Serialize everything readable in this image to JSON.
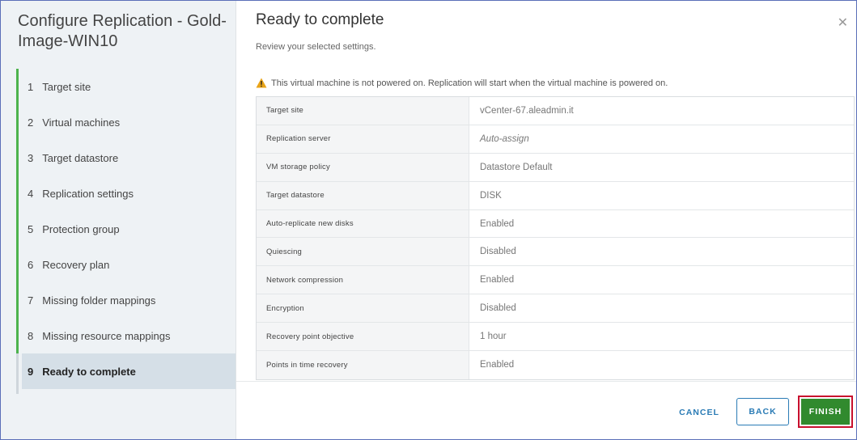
{
  "wizard": {
    "title": "Configure Replication - Gold-Image-WIN10",
    "steps": [
      {
        "num": "1",
        "label": "Target site"
      },
      {
        "num": "2",
        "label": "Virtual machines"
      },
      {
        "num": "3",
        "label": "Target datastore"
      },
      {
        "num": "4",
        "label": "Replication settings"
      },
      {
        "num": "5",
        "label": "Protection group"
      },
      {
        "num": "6",
        "label": "Recovery plan"
      },
      {
        "num": "7",
        "label": "Missing folder mappings"
      },
      {
        "num": "8",
        "label": "Missing resource mappings"
      },
      {
        "num": "9",
        "label": "Ready to complete"
      }
    ],
    "active_step": 9
  },
  "main": {
    "title": "Ready to complete",
    "subtitle": "Review your selected settings.",
    "close_icon": "close-icon",
    "warning_icon": "warning-icon",
    "warning_color": "#e8a317",
    "warning_text": "This virtual machine is not powered on. Replication will start when the virtual machine is powered on.",
    "settings": [
      {
        "key": "Target site",
        "value": "vCenter-67.aleadmin.it"
      },
      {
        "key": "Replication server",
        "value": "Auto-assign"
      },
      {
        "key": "VM storage policy",
        "value": "Datastore Default"
      },
      {
        "key": "Target datastore",
        "value": "DISK"
      },
      {
        "key": "Auto-replicate new disks",
        "value": "Enabled"
      },
      {
        "key": "Quiescing",
        "value": "Disabled"
      },
      {
        "key": "Network compression",
        "value": "Enabled"
      },
      {
        "key": "Encryption",
        "value": "Disabled"
      },
      {
        "key": "Recovery point objective",
        "value": "1 hour"
      },
      {
        "key": "Points in time recovery",
        "value": "Enabled"
      }
    ]
  },
  "footer": {
    "cancel_label": "CANCEL",
    "back_label": "BACK",
    "finish_label": "FINISH",
    "accent_color": "#2a7bb5",
    "finish_color": "#318a2e",
    "highlight_color": "#c8102e"
  }
}
